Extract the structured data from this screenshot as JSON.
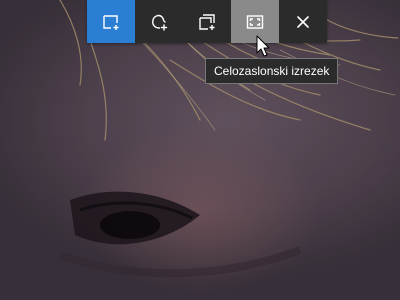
{
  "toolbar": {
    "buttons": [
      {
        "id": "rectangular-snip",
        "icon": "rectangle-snip-icon",
        "state": "active"
      },
      {
        "id": "freeform-snip",
        "icon": "freeform-snip-icon",
        "state": "normal"
      },
      {
        "id": "window-snip",
        "icon": "window-snip-icon",
        "state": "normal"
      },
      {
        "id": "fullscreen-snip",
        "icon": "fullscreen-snip-icon",
        "state": "hover"
      },
      {
        "id": "close",
        "icon": "close-icon",
        "state": "normal"
      }
    ],
    "tooltip": "Celozaslonski izrezek"
  },
  "colors": {
    "toolbar_bg": "#2b2b2b",
    "active_accent": "#2a7fd4",
    "hover_bg": "#8a8a8a"
  }
}
